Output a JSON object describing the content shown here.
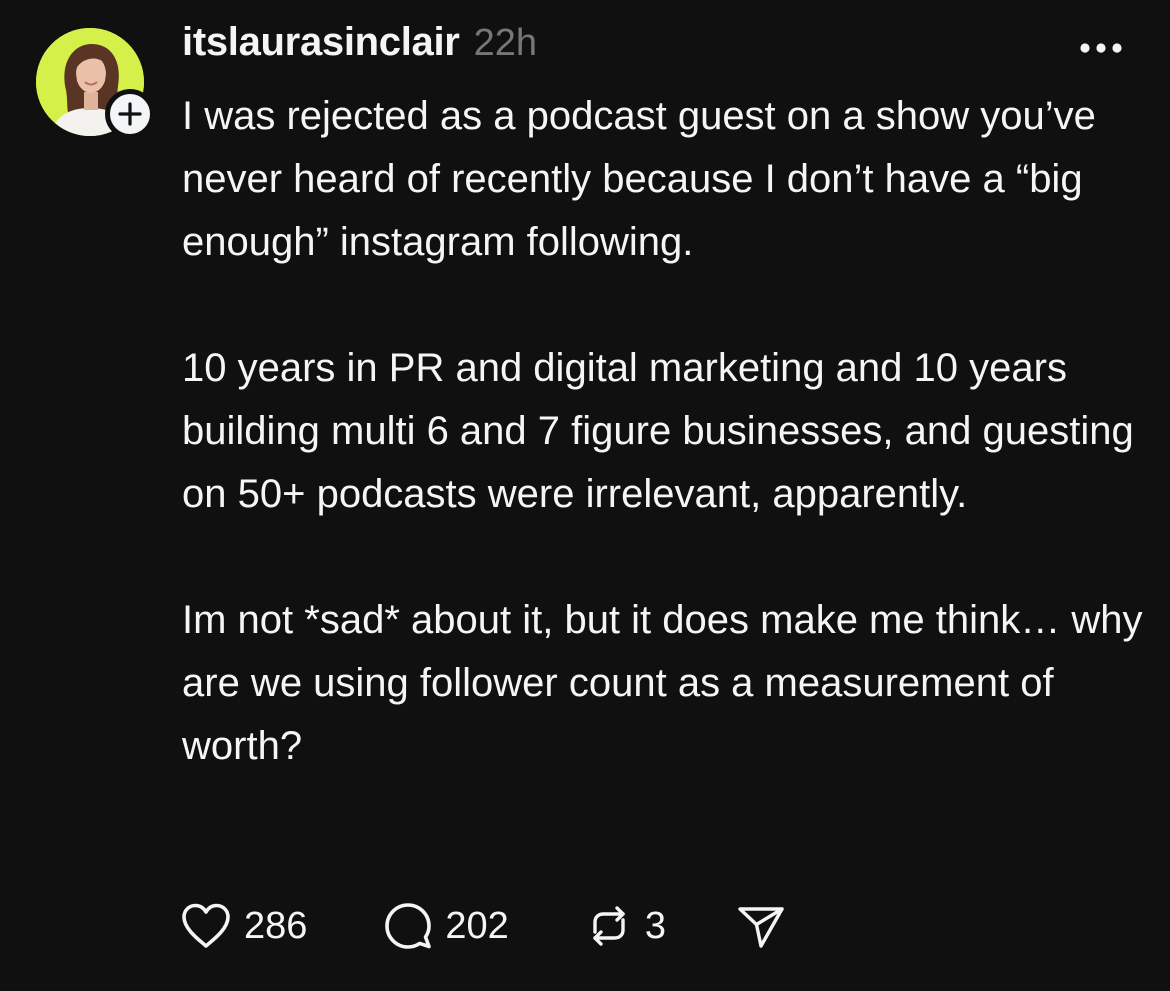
{
  "post": {
    "username": "itslaurasinclair",
    "timestamp": "22h",
    "paragraphs": [
      "I was rejected as a podcast guest on a show you’ve never heard of recently because I don’t have a “big enough” instagram following.",
      "10 years in PR and digital marketing and 10 years building multi 6 and 7 figure businesses, and guesting on 50+ podcasts were irrelevant, apparently.",
      "Im not *sad* about it, but it does make me think… why are we using follower count as a measurement of worth?"
    ]
  },
  "actions": {
    "likes": "286",
    "replies": "202",
    "reposts": "3"
  },
  "icons": {
    "avatar": "profile-photo",
    "follow": "plus-icon",
    "more": "ellipsis-icon",
    "like": "heart-icon",
    "reply": "speech-bubble-icon",
    "repost": "repost-icon",
    "share": "paper-plane-icon"
  },
  "colors": {
    "background": "#101010",
    "text": "#f3f5f7",
    "muted": "#777777",
    "avatar_bg": "#d6f04a"
  }
}
